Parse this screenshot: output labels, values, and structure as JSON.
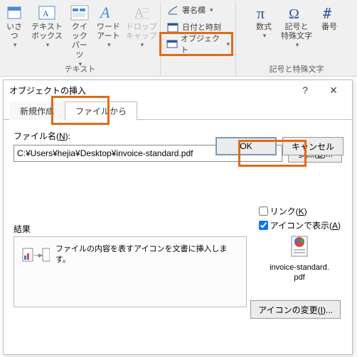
{
  "ribbon": {
    "group_text_label": "テキスト",
    "group_symbols_label": "記号と特殊文字",
    "aisatsu": "いさつ",
    "textbox": "テキスト\nボックス",
    "quickparts": "クイック パーツ",
    "wordart": "ワード\nアート",
    "dropcap": "ドロップ\nキャップ",
    "sig_line": "署名欄",
    "datetime": "日付と時刻",
    "object": "オブジェクト",
    "equation": "数式",
    "symbol": "記号と\n特殊文字",
    "number": "番号"
  },
  "dialog": {
    "title": "オブジェクトの挿入",
    "tab_new": "新規作成",
    "tab_file": "ファイルから",
    "filename_label": "ファイル名(N):",
    "filename_value": "C:¥Users¥hejia¥Desktop¥invoice-standard.pdf",
    "browse": "参照(B)...",
    "link": "リンク(K)",
    "as_icon": "アイコンで表示(A)",
    "result_title": "結果",
    "result_text": "ファイルの内容を表すアイコンを文書に挿入します。",
    "preview_caption": "invoice-standard.pdf",
    "change_icon": "アイコンの変更(I)...",
    "ok": "OK",
    "cancel": "キャンセル",
    "link_checked": false,
    "icon_checked": true
  }
}
